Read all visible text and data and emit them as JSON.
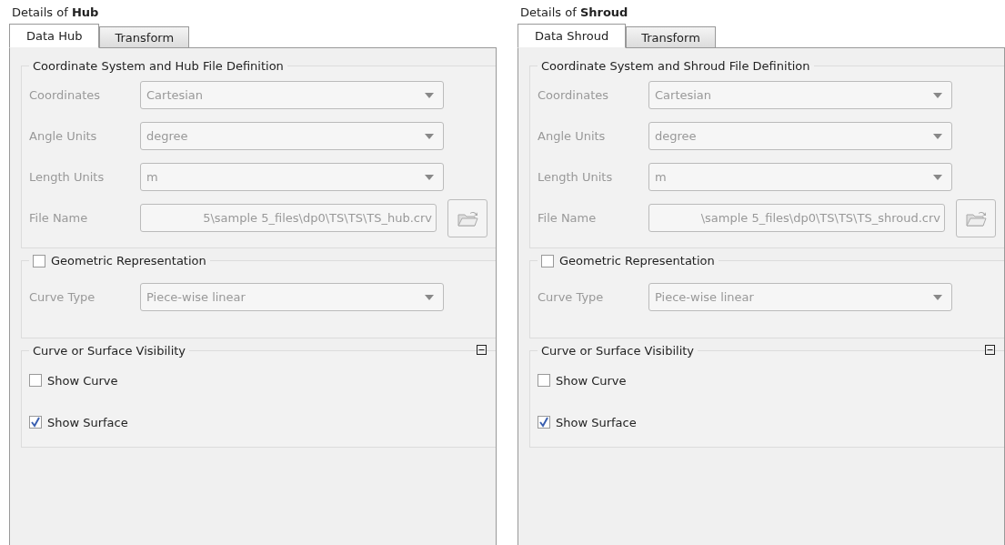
{
  "panels": [
    {
      "title": "Details of **Hub**",
      "tabs": [
        {
          "label": "Data Hub",
          "selected": true
        },
        {
          "label": "Transform",
          "selected": false
        }
      ],
      "coordinate_group": {
        "title": "Coordinate System and Hub File Definition",
        "fields": [
          {
            "kind": "combo",
            "label": "Coordinates",
            "value": "Cartesian"
          },
          {
            "kind": "combo",
            "label": "Angle Units",
            "value": "degree"
          },
          {
            "kind": "combo",
            "label": "Length Units",
            "value": "m"
          },
          {
            "kind": "file",
            "label": "File Name",
            "value": "5\\sample 5_files\\dp0\\TS\\TS\\TS_hub.crv"
          }
        ]
      },
      "geometry_group": {
        "title": "Geometric Representation",
        "checked": false,
        "fields": [
          {
            "kind": "combo",
            "label": "Curve Type",
            "value": "Piece-wise linear"
          }
        ]
      },
      "visibility_group": {
        "title": "Curve or Surface Visibility",
        "expanded": true,
        "options": [
          {
            "label": "Show Curve",
            "checked": false
          },
          {
            "label": "Show Surface",
            "checked": true
          }
        ]
      }
    },
    {
      "title": "Details of **Shroud**",
      "tabs": [
        {
          "label": "Data Shroud",
          "selected": true
        },
        {
          "label": "Transform",
          "selected": false
        }
      ],
      "coordinate_group": {
        "title": "Coordinate System and Shroud File Definition",
        "fields": [
          {
            "kind": "combo",
            "label": "Coordinates",
            "value": "Cartesian"
          },
          {
            "kind": "combo",
            "label": "Angle Units",
            "value": "degree"
          },
          {
            "kind": "combo",
            "label": "Length Units",
            "value": "m"
          },
          {
            "kind": "file",
            "label": "File Name",
            "value": "\\sample 5_files\\dp0\\TS\\TS\\TS_shroud.crv"
          }
        ]
      },
      "geometry_group": {
        "title": "Geometric Representation",
        "checked": false,
        "fields": [
          {
            "kind": "combo",
            "label": "Curve Type",
            "value": "Piece-wise linear"
          }
        ]
      },
      "visibility_group": {
        "title": "Curve or Surface Visibility",
        "expanded": true,
        "options": [
          {
            "label": "Show Curve",
            "checked": false
          },
          {
            "label": "Show Surface",
            "checked": true
          }
        ]
      }
    }
  ]
}
